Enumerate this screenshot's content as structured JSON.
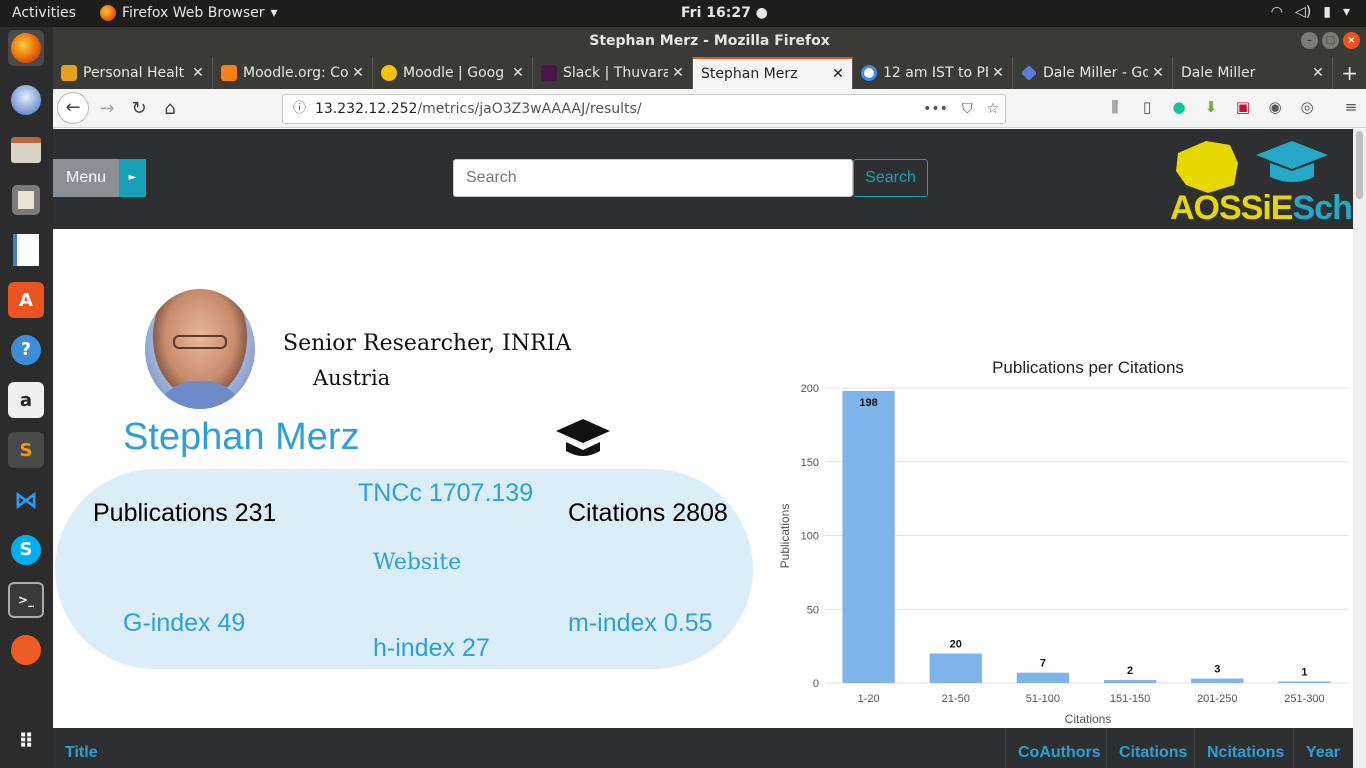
{
  "system": {
    "activities": "Activities",
    "app_name": "Firefox Web Browser",
    "clock": "Fri 16:27 ●"
  },
  "window": {
    "title": "Stephan Merz - Mozilla Firefox"
  },
  "tabs": [
    {
      "label": "Personal Healt",
      "color": "#e3a21a"
    },
    {
      "label": "Moodle.org: Co",
      "color": "#f98012"
    },
    {
      "label": "Moodle | Goog",
      "color": "#f4c20d"
    },
    {
      "label": "Slack | Thuvara",
      "color": "#4a154b"
    },
    {
      "label": "Stephan Merz",
      "color": ""
    },
    {
      "label": "12 am IST to PD",
      "color": "#4285f4"
    },
    {
      "label": "Dale Miller - Go",
      "color": "#5c7ce0"
    },
    {
      "label": "Dale Miller",
      "color": ""
    }
  ],
  "url": {
    "host": "13.232.12.252",
    "path": "/metrics/jaO3Z3wAAAAJ/results/"
  },
  "header": {
    "menu_label": "Menu",
    "search_placeholder": "Search",
    "search_button": "Search",
    "logo_part1": "AOSSiE",
    "logo_part2": "Scholar"
  },
  "profile": {
    "role": "Senior Researcher, INRIA",
    "country": "Austria",
    "name": "Stephan Merz"
  },
  "metrics": {
    "publications": "Publications 231",
    "tncc": "TNCc 1707.139",
    "citations": "Citations 2808",
    "website": "Website",
    "g_index": "G-index 49",
    "h_index": "h-index 27",
    "m_index": "m-index 0.55"
  },
  "chart_data": {
    "type": "bar",
    "title": "Publications per Citations",
    "xlabel": "Citations",
    "ylabel": "Publications",
    "categories": [
      "1-20",
      "21-50",
      "51-100",
      "151-150",
      "201-250",
      "251-300"
    ],
    "values": [
      198,
      20,
      7,
      2,
      3,
      1
    ],
    "ylim": [
      0,
      200
    ],
    "yticks": [
      0,
      50,
      100,
      150,
      200
    ],
    "bar_color": "#7fb4ea",
    "grid": true
  },
  "table": {
    "headers": [
      "Title",
      "CoAuthors",
      "Citations",
      "Ncitations",
      "Year"
    ]
  }
}
